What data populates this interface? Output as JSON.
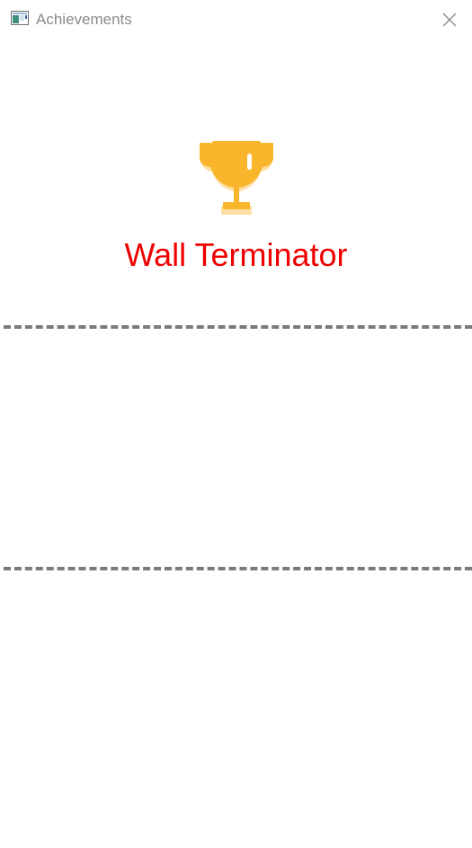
{
  "window": {
    "title": "Achievements",
    "app_icon": "app-window-icon",
    "close_icon": "close-icon"
  },
  "achievement": {
    "icon": "trophy-icon",
    "name": "Wall Terminator",
    "icon_color": "#F9B62D",
    "name_color": "#EE0000"
  },
  "colors": {
    "divider": "#7B7B7B",
    "title_text": "#8A8A8A",
    "background": "#FFFFFF"
  }
}
